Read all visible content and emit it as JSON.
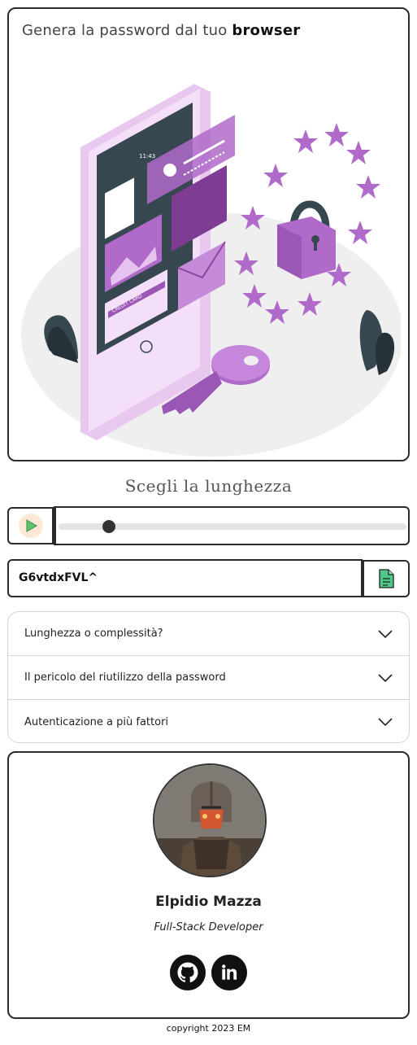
{
  "hero": {
    "title_prefix": "Genera la password dal tuo ",
    "title_bold": "browser",
    "illustration_label": "CREDIT CARD",
    "illustration_time": "11:43"
  },
  "length": {
    "title": "Scegli la lunghezza",
    "slider_value_fraction": 0.13
  },
  "password": {
    "value": "G6vtdxFVL^"
  },
  "faq": {
    "items": [
      {
        "label": "Lunghezza o complessità?"
      },
      {
        "label": "Il pericolo del riutilizzo della password"
      },
      {
        "label": "Autenticazione a più fattori"
      }
    ]
  },
  "profile": {
    "name": "Elpidio Mazza",
    "role": "Full-Stack Developer",
    "social_icons": [
      "github-icon",
      "linkedin-icon"
    ]
  },
  "footer": {
    "copyright": "copyright 2023 EM"
  },
  "colors": {
    "accent_purple": "#b06ac9",
    "copy_green": "#4fc98a",
    "play_green": "#5cc46a",
    "play_bg": "#fde8d6"
  }
}
